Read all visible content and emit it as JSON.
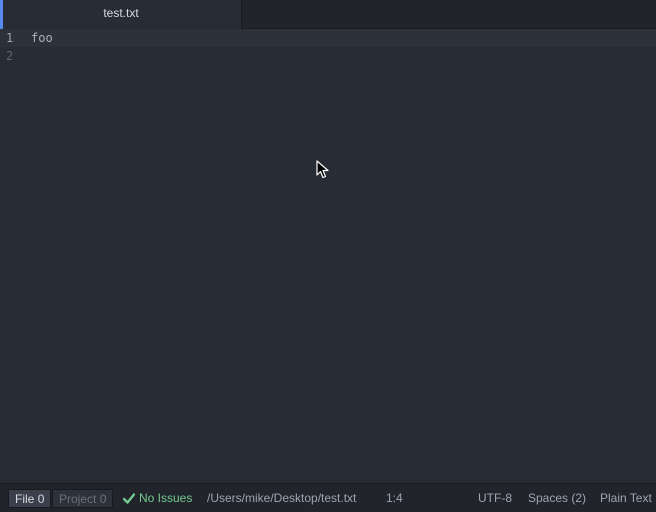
{
  "tabs": [
    {
      "label": "test.txt",
      "active": true
    }
  ],
  "editor": {
    "lines": [
      {
        "number": "1",
        "text": "foo"
      },
      {
        "number": "2",
        "text": ""
      }
    ]
  },
  "status_bar": {
    "file_label": "File",
    "file_count": "0",
    "project_label": "Project",
    "project_count": "0",
    "issues": "No Issues",
    "path": "/Users/mike/Desktop/test.txt",
    "cursor_position": "1:4",
    "encoding": "UTF-8",
    "indentation": "Spaces (2)",
    "grammar": "Plain Text"
  },
  "colors": {
    "accent": "#568af2",
    "success": "#73c990",
    "background": "#282c34",
    "panel": "#21252b"
  },
  "icons": {
    "issues_icon": "checkmark-icon",
    "pointer": "mouse-pointer-icon"
  }
}
